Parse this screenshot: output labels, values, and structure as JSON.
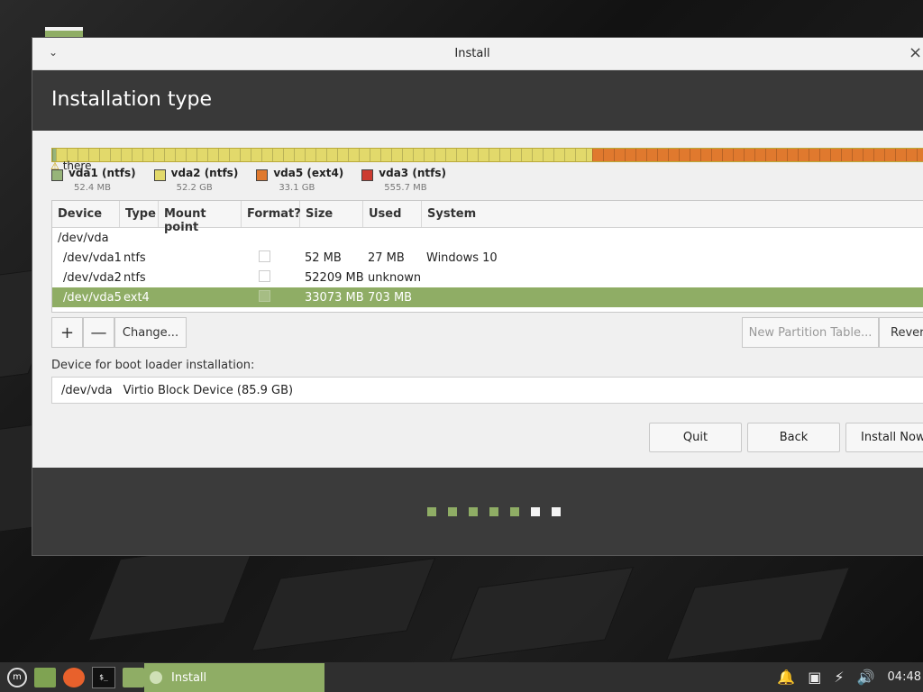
{
  "window": {
    "title": "Install"
  },
  "page": {
    "heading": "Installation type"
  },
  "warning_text": "there",
  "legend": [
    {
      "name": "vda1 (ntfs)",
      "size": "52.4 MB",
      "color": "#97b47a"
    },
    {
      "name": "vda2 (ntfs)",
      "size": "52.2 GB",
      "color": "#e2d96b"
    },
    {
      "name": "vda5 (ext4)",
      "size": "33.1 GB",
      "color": "#e0792e"
    },
    {
      "name": "vda3 (ntfs)",
      "size": "555.7 MB",
      "color": "#cc3b30"
    }
  ],
  "table": {
    "headers": [
      "Device",
      "Type",
      "Mount point",
      "Format?",
      "Size",
      "Used",
      "System"
    ],
    "disk": "/dev/vda",
    "rows": [
      {
        "device": "/dev/vda1",
        "type": "ntfs",
        "mount": "",
        "size": "52 MB",
        "used": "27 MB",
        "system": "Windows 10"
      },
      {
        "device": "/dev/vda2",
        "type": "ntfs",
        "mount": "",
        "size": "52209 MB",
        "used": "unknown",
        "system": ""
      },
      {
        "device": "/dev/vda5",
        "type": "ext4",
        "mount": "",
        "size": "33073 MB",
        "used": "703 MB",
        "system": ""
      }
    ]
  },
  "partition_toolbar": {
    "add": "+",
    "remove": "—",
    "change": "Change...",
    "new_table": "New Partition Table...",
    "revert": "Rever"
  },
  "bootloader": {
    "label": "Device for boot loader installation:",
    "device": "/dev/vda",
    "description": "Virtio Block Device (85.9 GB)"
  },
  "buttons": {
    "quit": "Quit",
    "back": "Back",
    "install": "Install Now"
  },
  "progress": {
    "completed_steps": 5,
    "total_steps": 7
  },
  "taskbar": {
    "task": "Install",
    "clock": "04:48"
  },
  "colors": {
    "accent": "#8fad65",
    "header": "#393939"
  }
}
